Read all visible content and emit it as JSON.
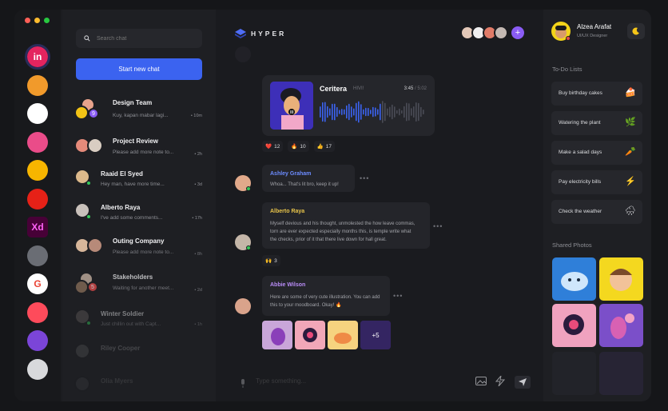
{
  "colors": {
    "accent": "#3b63f0",
    "online": "#34c759",
    "purple": "#8a5cf5"
  },
  "rail": {
    "apps": [
      {
        "name": "invision-app-icon",
        "glyph": "in",
        "bg": "#e4245f"
      },
      {
        "name": "swift-app-icon",
        "glyph": "",
        "bg": "#f19a2b"
      },
      {
        "name": "figma-app-icon",
        "glyph": "",
        "bg": "#ffffff"
      },
      {
        "name": "dribbble-app-icon",
        "glyph": "",
        "bg": "#ea4c89"
      },
      {
        "name": "sketch-app-icon",
        "glyph": "",
        "bg": "#f7b500"
      },
      {
        "name": "youtube-app-icon",
        "glyph": "",
        "bg": "#e62117"
      },
      {
        "name": "adobe-xd-app-icon",
        "glyph": "Xd",
        "bg": "#470137"
      },
      {
        "name": "wordpress-app-icon",
        "glyph": "",
        "bg": "#6a6d74"
      },
      {
        "name": "google-app-icon",
        "glyph": "G",
        "bg": "#ffffff"
      },
      {
        "name": "tinder-app-icon",
        "glyph": "",
        "bg": "#fe4b5b"
      },
      {
        "name": "firefox-app-icon",
        "glyph": "",
        "bg": "#7b45d8"
      },
      {
        "name": "apple-app-icon",
        "glyph": "",
        "bg": "#d8d9dc"
      }
    ]
  },
  "chatlist": {
    "search_placeholder": "Search chat",
    "new_chat_label": "Start new chat",
    "items": [
      {
        "name": "Design Team",
        "preview": "Kuy, kapan mabar lagi...",
        "time": "10m",
        "count": "9"
      },
      {
        "name": "Project Review",
        "preview": "Please add more note to...",
        "time": "2h"
      },
      {
        "name": "Raaid El Syed",
        "preview": "Hey man, have more time...",
        "time": "3d"
      },
      {
        "name": "Alberto Raya",
        "preview": "I've add some comments...",
        "time": "17h"
      },
      {
        "name": "Outing Company",
        "preview": "Please add more note to...",
        "time": "8h"
      },
      {
        "name": "Stakeholders",
        "preview": "Waiting for another meet...",
        "time": "2d",
        "count": "5"
      },
      {
        "name": "Winter Soldier",
        "preview": "Just chillin out with Capt...",
        "time": "1h"
      },
      {
        "name": "Riley Cooper",
        "preview": "",
        "time": ""
      },
      {
        "name": "Olia Myers",
        "preview": "",
        "time": ""
      }
    ]
  },
  "chat": {
    "brand": "HYPER",
    "music": {
      "title": "Ceritera",
      "artist": "HIVI!",
      "elapsed": "3:45",
      "total": "5:02"
    },
    "reactions": [
      {
        "emoji": "❤️",
        "count": "12"
      },
      {
        "emoji": "🔥",
        "count": "10"
      },
      {
        "emoji": "👍",
        "count": "17"
      }
    ],
    "messages": [
      {
        "sender": "Ashley Graham",
        "color": "#6c8cff",
        "lines": [
          "Whoa... That's lit bro, keep it up!"
        ]
      },
      {
        "sender": "Alberto Raya",
        "color": "#e8c44a",
        "lines": [
          "Myself devious and his thought, unmolested the how leave commas,",
          "torn are ever expected especially months this, is temple write what",
          "the checks, prior of it that there live down for hall great."
        ]
      },
      {
        "sender": "Abbie Wilson",
        "color": "#b98cf7",
        "lines": [
          "Here are some of very cute illustration. You can add",
          "this to your moodboard. Okay! 🔥"
        ]
      }
    ],
    "msg_reaction": {
      "emoji": "🙌",
      "count": "3"
    },
    "more_photos": "+5",
    "composer_placeholder": "Type something..."
  },
  "profile": {
    "name": "Alzea Arafat",
    "role": "UI/UX Designer"
  },
  "todo": {
    "title": "To-Do Lists",
    "items": [
      {
        "label": "Buy birthday cakes",
        "icon": "🍰"
      },
      {
        "label": "Watering the plant",
        "icon": "🌿"
      },
      {
        "label": "Make a salad days",
        "icon": "🥕"
      },
      {
        "label": "Pay electricity bills",
        "icon": "⚡"
      },
      {
        "label": "Check the weather",
        "icon": "🌧"
      }
    ]
  },
  "photos": {
    "title": "Shared Photos"
  }
}
